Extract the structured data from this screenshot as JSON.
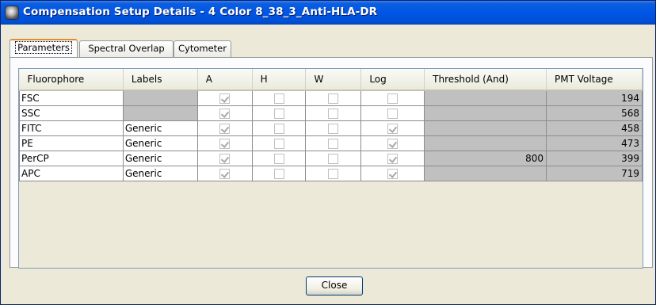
{
  "window": {
    "title": "Compensation Setup Details - 4 Color 8_38_3_Anti-HLA-DR"
  },
  "tabs": [
    {
      "label": "Parameters",
      "active": true
    },
    {
      "label": "Spectral Overlap",
      "active": false
    },
    {
      "label": "Cytometer",
      "active": false
    }
  ],
  "table": {
    "columns": [
      "Fluorophore",
      "Labels",
      "A",
      "H",
      "W",
      "Log",
      "Threshold (And)",
      "PMT Voltage"
    ],
    "rows": [
      {
        "fluorophore": "FSC",
        "label": "",
        "a": true,
        "h": false,
        "w": false,
        "log": false,
        "threshold": "",
        "pmt": "194"
      },
      {
        "fluorophore": "SSC",
        "label": "",
        "a": true,
        "h": false,
        "w": false,
        "log": false,
        "threshold": "",
        "pmt": "568"
      },
      {
        "fluorophore": "FITC",
        "label": "Generic",
        "a": true,
        "h": false,
        "w": false,
        "log": true,
        "threshold": "",
        "pmt": "458"
      },
      {
        "fluorophore": "PE",
        "label": "Generic",
        "a": true,
        "h": false,
        "w": false,
        "log": true,
        "threshold": "",
        "pmt": "473"
      },
      {
        "fluorophore": "PerCP",
        "label": "Generic",
        "a": true,
        "h": false,
        "w": false,
        "log": true,
        "threshold": "800",
        "pmt": "399"
      },
      {
        "fluorophore": "APC",
        "label": "Generic",
        "a": true,
        "h": false,
        "w": false,
        "log": true,
        "threshold": "",
        "pmt": "719"
      }
    ]
  },
  "buttons": {
    "close": "Close"
  },
  "colors": {
    "titlebar": "#0055e5",
    "dialog_background": "#ece9d8",
    "disabled_cell": "#c0c0c0",
    "active_tab_highlight": "#e68b2c"
  },
  "icons": {
    "app": "dialog-app-icon",
    "checkbox_checked": "checkmark-icon"
  }
}
